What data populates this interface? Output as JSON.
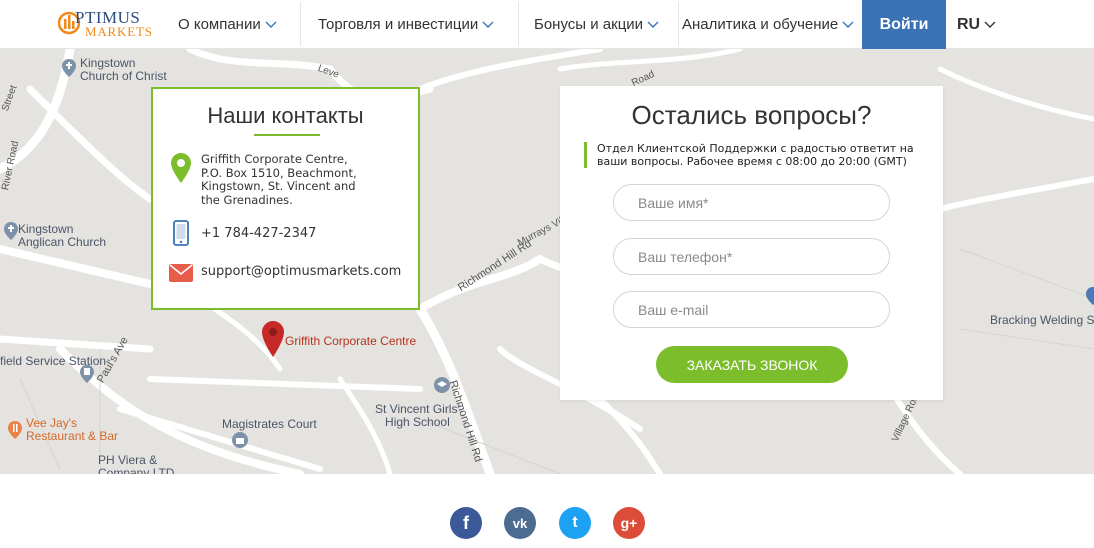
{
  "header": {
    "logo": {
      "line1": "PTIMUS",
      "line2": "MARKETS"
    },
    "nav": [
      {
        "label": "О компании"
      },
      {
        "label": "Торговля и инвестиции"
      },
      {
        "label": "Бонусы и акции"
      },
      {
        "label": "Аналитика и обучение"
      }
    ],
    "login_label": "Войти",
    "lang_label": "RU"
  },
  "map": {
    "labels": {
      "kingstown_church": "Kingstown\nChurch of Christ",
      "kingstown_anglican": "Kingstown\nAnglican Church",
      "griffith_pin": "Griffith Corporate Centre",
      "field_service": "field Service Station",
      "vee_jays": "Vee Jay's\nRestaurant & Bar",
      "magistrates": "Magistrates Court",
      "st_vincent": "St Vincent Girls'\nHigh School",
      "ph_viera": "PH Viera &\nCompany LTD",
      "bracking": "Bracking Welding Ser",
      "richmond_hill_1": "Richmond Hill Rd",
      "richmond_hill_2": "Richmond Hill Rd",
      "pauls_ave": "Paul's Ave",
      "murrays_vill": "Murrays Vill",
      "river_road": "River Road",
      "leve": "Leve",
      "road_top": "Road",
      "village_road": "Village Road",
      "street": "Street"
    }
  },
  "contacts": {
    "title": "Наши контакты",
    "address": "Griffith Corporate Centre,\nP.O. Box 1510, Beachmont,\nKingstown, St. Vincent and\nthe Grenadines.",
    "phone": "+1 784-427-2347",
    "email": "support@optimusmarkets.com"
  },
  "form": {
    "title": "Остались вопросы?",
    "description": "Отдел Клиентской Поддержки с радостью ответит на ваши вопросы. Рабочее время с 08:00 до 20:00 (GMT)",
    "name_placeholder": "Ваше имя*",
    "phone_placeholder": "Ваш телефон*",
    "email_placeholder": "Ваш e-mail",
    "submit_label": "Заказать звонок"
  },
  "footer": {
    "social": [
      {
        "name": "facebook",
        "glyph": "f",
        "color": "#3b5998"
      },
      {
        "name": "vkontakte",
        "glyph": "vk",
        "color": "#4c6c91"
      },
      {
        "name": "twitter",
        "glyph": "t",
        "color": "#1da1f2"
      },
      {
        "name": "google-plus",
        "glyph": "g+",
        "color": "#dd4b39"
      }
    ]
  },
  "colors": {
    "accent_green": "#7cbd2b",
    "brand_blue": "#3b72b5",
    "logo_orange": "#f08a1c",
    "pin_red": "#c62828"
  }
}
